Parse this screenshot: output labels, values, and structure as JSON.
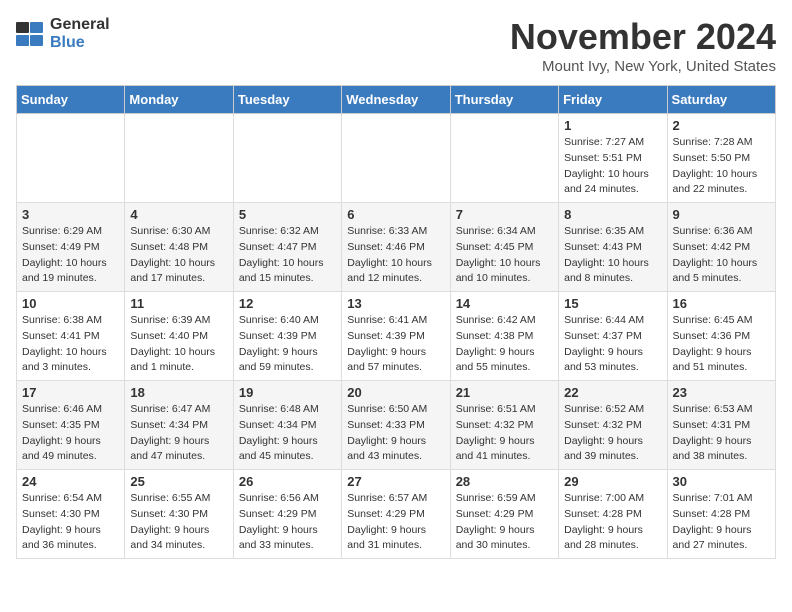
{
  "header": {
    "logo_general": "General",
    "logo_blue": "Blue",
    "title": "November 2024",
    "subtitle": "Mount Ivy, New York, United States"
  },
  "days_of_week": [
    "Sunday",
    "Monday",
    "Tuesday",
    "Wednesday",
    "Thursday",
    "Friday",
    "Saturday"
  ],
  "weeks": [
    [
      {
        "day": "",
        "info": ""
      },
      {
        "day": "",
        "info": ""
      },
      {
        "day": "",
        "info": ""
      },
      {
        "day": "",
        "info": ""
      },
      {
        "day": "",
        "info": ""
      },
      {
        "day": "1",
        "info": "Sunrise: 7:27 AM\nSunset: 5:51 PM\nDaylight: 10 hours\nand 24 minutes."
      },
      {
        "day": "2",
        "info": "Sunrise: 7:28 AM\nSunset: 5:50 PM\nDaylight: 10 hours\nand 22 minutes."
      }
    ],
    [
      {
        "day": "3",
        "info": "Sunrise: 6:29 AM\nSunset: 4:49 PM\nDaylight: 10 hours\nand 19 minutes."
      },
      {
        "day": "4",
        "info": "Sunrise: 6:30 AM\nSunset: 4:48 PM\nDaylight: 10 hours\nand 17 minutes."
      },
      {
        "day": "5",
        "info": "Sunrise: 6:32 AM\nSunset: 4:47 PM\nDaylight: 10 hours\nand 15 minutes."
      },
      {
        "day": "6",
        "info": "Sunrise: 6:33 AM\nSunset: 4:46 PM\nDaylight: 10 hours\nand 12 minutes."
      },
      {
        "day": "7",
        "info": "Sunrise: 6:34 AM\nSunset: 4:45 PM\nDaylight: 10 hours\nand 10 minutes."
      },
      {
        "day": "8",
        "info": "Sunrise: 6:35 AM\nSunset: 4:43 PM\nDaylight: 10 hours\nand 8 minutes."
      },
      {
        "day": "9",
        "info": "Sunrise: 6:36 AM\nSunset: 4:42 PM\nDaylight: 10 hours\nand 5 minutes."
      }
    ],
    [
      {
        "day": "10",
        "info": "Sunrise: 6:38 AM\nSunset: 4:41 PM\nDaylight: 10 hours\nand 3 minutes."
      },
      {
        "day": "11",
        "info": "Sunrise: 6:39 AM\nSunset: 4:40 PM\nDaylight: 10 hours\nand 1 minute."
      },
      {
        "day": "12",
        "info": "Sunrise: 6:40 AM\nSunset: 4:39 PM\nDaylight: 9 hours\nand 59 minutes."
      },
      {
        "day": "13",
        "info": "Sunrise: 6:41 AM\nSunset: 4:39 PM\nDaylight: 9 hours\nand 57 minutes."
      },
      {
        "day": "14",
        "info": "Sunrise: 6:42 AM\nSunset: 4:38 PM\nDaylight: 9 hours\nand 55 minutes."
      },
      {
        "day": "15",
        "info": "Sunrise: 6:44 AM\nSunset: 4:37 PM\nDaylight: 9 hours\nand 53 minutes."
      },
      {
        "day": "16",
        "info": "Sunrise: 6:45 AM\nSunset: 4:36 PM\nDaylight: 9 hours\nand 51 minutes."
      }
    ],
    [
      {
        "day": "17",
        "info": "Sunrise: 6:46 AM\nSunset: 4:35 PM\nDaylight: 9 hours\nand 49 minutes."
      },
      {
        "day": "18",
        "info": "Sunrise: 6:47 AM\nSunset: 4:34 PM\nDaylight: 9 hours\nand 47 minutes."
      },
      {
        "day": "19",
        "info": "Sunrise: 6:48 AM\nSunset: 4:34 PM\nDaylight: 9 hours\nand 45 minutes."
      },
      {
        "day": "20",
        "info": "Sunrise: 6:50 AM\nSunset: 4:33 PM\nDaylight: 9 hours\nand 43 minutes."
      },
      {
        "day": "21",
        "info": "Sunrise: 6:51 AM\nSunset: 4:32 PM\nDaylight: 9 hours\nand 41 minutes."
      },
      {
        "day": "22",
        "info": "Sunrise: 6:52 AM\nSunset: 4:32 PM\nDaylight: 9 hours\nand 39 minutes."
      },
      {
        "day": "23",
        "info": "Sunrise: 6:53 AM\nSunset: 4:31 PM\nDaylight: 9 hours\nand 38 minutes."
      }
    ],
    [
      {
        "day": "24",
        "info": "Sunrise: 6:54 AM\nSunset: 4:30 PM\nDaylight: 9 hours\nand 36 minutes."
      },
      {
        "day": "25",
        "info": "Sunrise: 6:55 AM\nSunset: 4:30 PM\nDaylight: 9 hours\nand 34 minutes."
      },
      {
        "day": "26",
        "info": "Sunrise: 6:56 AM\nSunset: 4:29 PM\nDaylight: 9 hours\nand 33 minutes."
      },
      {
        "day": "27",
        "info": "Sunrise: 6:57 AM\nSunset: 4:29 PM\nDaylight: 9 hours\nand 31 minutes."
      },
      {
        "day": "28",
        "info": "Sunrise: 6:59 AM\nSunset: 4:29 PM\nDaylight: 9 hours\nand 30 minutes."
      },
      {
        "day": "29",
        "info": "Sunrise: 7:00 AM\nSunset: 4:28 PM\nDaylight: 9 hours\nand 28 minutes."
      },
      {
        "day": "30",
        "info": "Sunrise: 7:01 AM\nSunset: 4:28 PM\nDaylight: 9 hours\nand 27 minutes."
      }
    ]
  ]
}
